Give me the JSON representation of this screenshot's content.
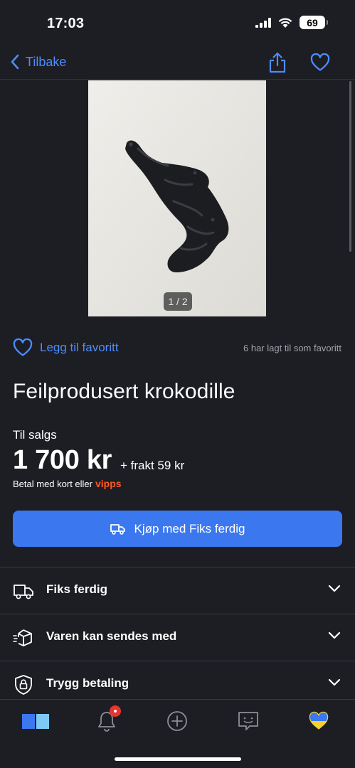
{
  "status": {
    "time": "17:03",
    "battery": "69"
  },
  "nav": {
    "back_label": "Tilbake"
  },
  "gallery": {
    "counter": "1 / 2"
  },
  "favorite": {
    "label": "Legg til favoritt",
    "count_text": "6 har lagt til som favoritt"
  },
  "listing": {
    "title": "Feilprodusert krokodille",
    "sale_label": "Til salgs",
    "price": "1 700 kr",
    "shipping": "+ frakt 59 kr",
    "payment_text": "Betal med kort eller",
    "payment_brand": "vipps",
    "buy_button": "Kjøp med Fiks ferdig"
  },
  "accordion": [
    {
      "label": "Fiks ferdig",
      "icon": "truck-icon"
    },
    {
      "label": "Varen kan sendes med",
      "icon": "package-icon"
    },
    {
      "label": "Trygg betaling",
      "icon": "shield-lock-icon"
    }
  ],
  "tabs": [
    {
      "name": "home",
      "icon": "book-icon"
    },
    {
      "name": "notifications",
      "icon": "bell-icon"
    },
    {
      "name": "new-ad",
      "icon": "plus-circle-icon"
    },
    {
      "name": "messages",
      "icon": "chat-icon"
    },
    {
      "name": "favorites",
      "icon": "heart-icon"
    }
  ],
  "colors": {
    "accent": "#4c8dff",
    "button": "#3b78f0",
    "background": "#1d1d24",
    "vipps": "#ff5b24",
    "badge": "#e5352f"
  }
}
